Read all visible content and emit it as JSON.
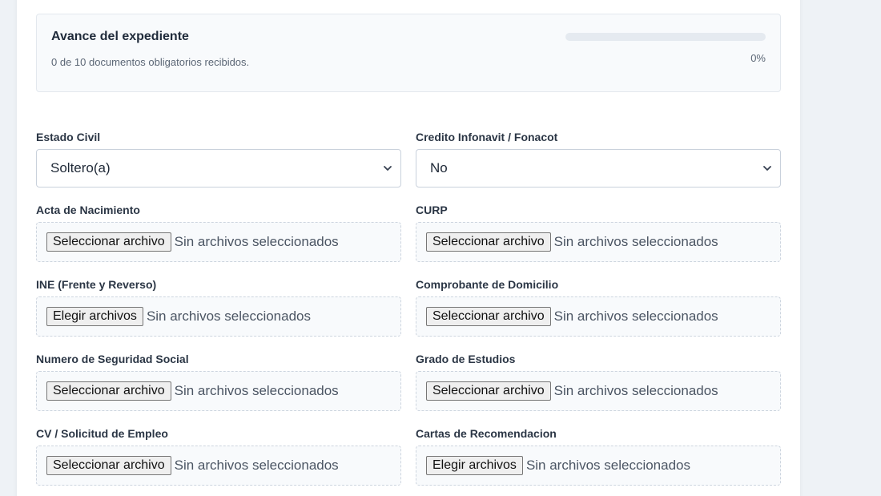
{
  "progress": {
    "title": "Avance del expediente",
    "subtitle": "0 de 10 documentos obligatorios recibidos.",
    "percent_label": "0%",
    "value": 0
  },
  "fields": {
    "estado_civil": {
      "label": "Estado Civil",
      "value": "Soltero(a)"
    },
    "credito": {
      "label": "Credito Infonavit / Fonacot",
      "value": "No"
    }
  },
  "uploads": [
    {
      "label": "Acta de Nacimiento",
      "button": "Seleccionar archivo",
      "status": "Sin archivos seleccionados"
    },
    {
      "label": "CURP",
      "button": "Seleccionar archivo",
      "status": "Sin archivos seleccionados"
    },
    {
      "label": "INE (Frente y Reverso)",
      "button": "Elegir archivos",
      "status": "Sin archivos seleccionados"
    },
    {
      "label": "Comprobante de Domicilio",
      "button": "Seleccionar archivo",
      "status": "Sin archivos seleccionados"
    },
    {
      "label": "Numero de Seguridad Social",
      "button": "Seleccionar archivo",
      "status": "Sin archivos seleccionados"
    },
    {
      "label": "Grado de Estudios",
      "button": "Seleccionar archivo",
      "status": "Sin archivos seleccionados"
    },
    {
      "label": "CV / Solicitud de Empleo",
      "button": "Seleccionar archivo",
      "status": "Sin archivos seleccionados"
    },
    {
      "label": "Cartas de Recomendacion",
      "button": "Elegir archivos",
      "status": "Sin archivos seleccionados"
    }
  ],
  "icons": {
    "select_arrow": "chevron-down-icon"
  },
  "colors": {
    "accent": "#3b82f6",
    "track": "#e5eaf0"
  }
}
